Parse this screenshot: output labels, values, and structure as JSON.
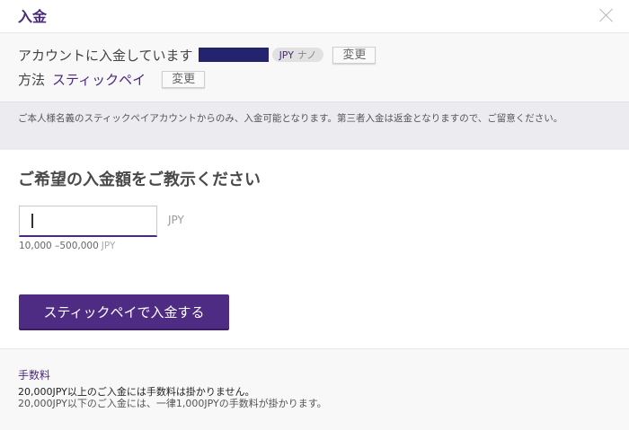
{
  "header": {
    "title": "入金",
    "close_icon": "close-icon"
  },
  "account": {
    "label": "アカウントに入金しています",
    "currency": "JPY",
    "account_type": "ナノ",
    "change_label": "変更"
  },
  "method": {
    "label": "方法",
    "name": "スティックペイ",
    "change_label": "変更"
  },
  "notice": {
    "text": "ご本人様名義のスティックペイアカウントからのみ、入金可能となります。第三者入金は返金となりますので、ご留意ください。"
  },
  "amount": {
    "title": "ご希望の入金額をご教示ください",
    "value": "",
    "currency": "JPY",
    "range": "10,000 –500,000",
    "range_unit": "JPY"
  },
  "submit": {
    "label": "スティックペイで入金する"
  },
  "fee": {
    "title": "手数料",
    "line1": "20,000JPY以上のご入金には手数料は掛かりません。",
    "line2": "20,000JPY以下のご入金には、一律1,000JPYの手数料が掛かります。"
  },
  "colors": {
    "accent": "#4f2c83",
    "masked": "#23236e"
  }
}
